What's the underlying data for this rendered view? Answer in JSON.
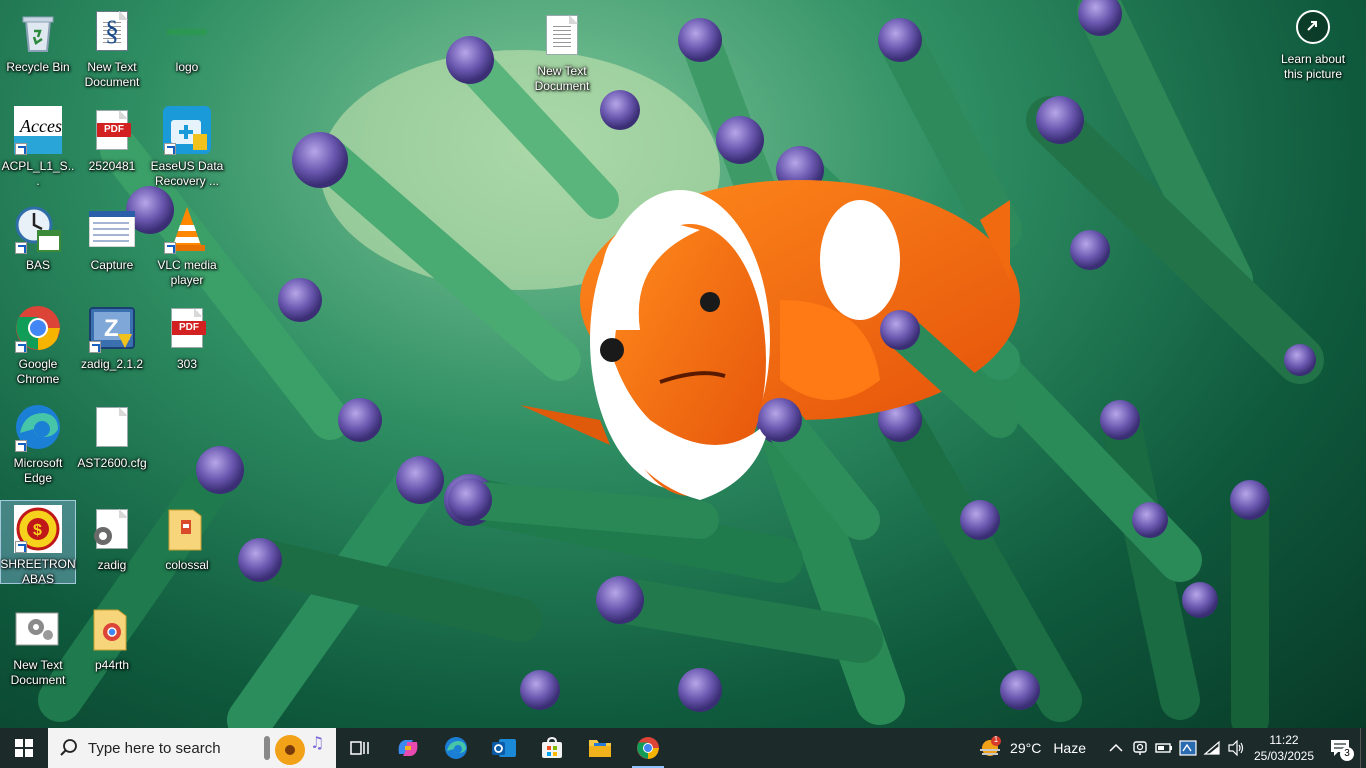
{
  "desktop": {
    "icons": [
      {
        "label": "Recycle Bin",
        "icon": "recycle-bin-icon"
      },
      {
        "label": "New Text Document",
        "icon": "text-document-icon"
      },
      {
        "label": "logo",
        "icon": "image-file-icon"
      },
      {
        "label": "New Text Document",
        "icon": "text-document-icon"
      },
      {
        "label": "ACPL_L1_S...",
        "icon": "access-app-icon"
      },
      {
        "label": "2520481",
        "icon": "pdf-file-icon"
      },
      {
        "label": "EaseUS Data Recovery ...",
        "icon": "easeus-app-icon"
      },
      {
        "label": "BAS",
        "icon": "clock-calendar-icon"
      },
      {
        "label": "Capture",
        "icon": "image-file-icon"
      },
      {
        "label": "VLC media player",
        "icon": "vlc-cone-icon"
      },
      {
        "label": "Google Chrome",
        "icon": "chrome-icon"
      },
      {
        "label": "zadig_2.1.2",
        "icon": "zadig-app-icon"
      },
      {
        "label": "303",
        "icon": "pdf-file-icon"
      },
      {
        "label": "Microsoft Edge",
        "icon": "edge-icon"
      },
      {
        "label": "AST2600.cfg",
        "icon": "blank-file-icon"
      },
      {
        "label": "SHREETRON ABAS",
        "icon": "shreetron-logo-icon"
      },
      {
        "label": "zadig",
        "icon": "settings-file-icon"
      },
      {
        "label": "colossal",
        "icon": "zip-folder-icon"
      },
      {
        "label": "New Text Document",
        "icon": "settings-document-icon"
      },
      {
        "label": "p44rth",
        "icon": "chrome-folder-icon"
      }
    ],
    "learn_label": "Learn about this picture",
    "pdf_badge": "PDF"
  },
  "taskbar": {
    "search_placeholder": "Type here to search",
    "apps": [
      "task-view-icon",
      "copilot-icon",
      "edge-icon",
      "outlook-icon",
      "store-icon",
      "file-explorer-icon",
      "chrome-icon"
    ],
    "weather": {
      "temp": "29°C",
      "condition": "Haze",
      "alert_count": "1"
    },
    "clock": {
      "time": "11:22",
      "date": "25/03/2025"
    },
    "notifications_count": "3"
  },
  "colors": {
    "taskbar": "#1c2a2a",
    "accent": "#8fc2ff",
    "clownfish": "#f26a10"
  }
}
